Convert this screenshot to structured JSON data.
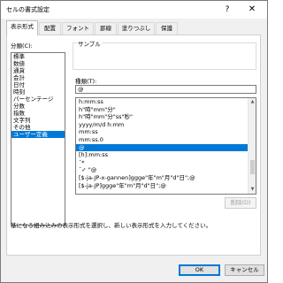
{
  "dialog": {
    "title": "セルの書式設定",
    "help_glyph": "?",
    "close_glyph": "✕"
  },
  "tabs": [
    {
      "label": "表示形式",
      "active": true
    },
    {
      "label": "配置"
    },
    {
      "label": "フォント"
    },
    {
      "label": "罫線"
    },
    {
      "label": "塗りつぶし"
    },
    {
      "label": "保護"
    }
  ],
  "category": {
    "label": "分類(C):",
    "items": [
      "標準",
      "数値",
      "通貨",
      "会計",
      "日付",
      "時刻",
      "パーセンテージ",
      "分数",
      "指数",
      "文字列",
      "その他",
      "ユーザー定義"
    ],
    "selected": "ユーザー定義"
  },
  "sample": {
    "label": "サンプル",
    "value": ""
  },
  "type_field": {
    "label": "種類(T):",
    "value": "@"
  },
  "formats": [
    "h:mm:ss",
    "h\"時\"mm\"分\"",
    "h\"時\"mm\"分\"ss\"秒\"",
    "yyyy/m/d h:mm",
    "mm:ss",
    "mm:ss.0",
    "@",
    "[h]:mm:ss",
    "¯* ",
    "¯✓ \"@",
    "[$-ja-JP-x-gannen]ggge\"年\"m\"月\"d\"日\";@",
    "[$-ja-JP]ggge\"年\"m\"月\"d\"日\";@"
  ],
  "selected_format": "@",
  "delete_button": "削除(D)",
  "description": "基になる組み込みの表示形式を選択し、新しい表示形式を入力してください。",
  "buttons": {
    "ok": "OK",
    "cancel": "キャンセル"
  },
  "colors": {
    "selection": "#0078d7",
    "panel": "#ffffff",
    "dialog_bg": "#f0f0f0"
  }
}
